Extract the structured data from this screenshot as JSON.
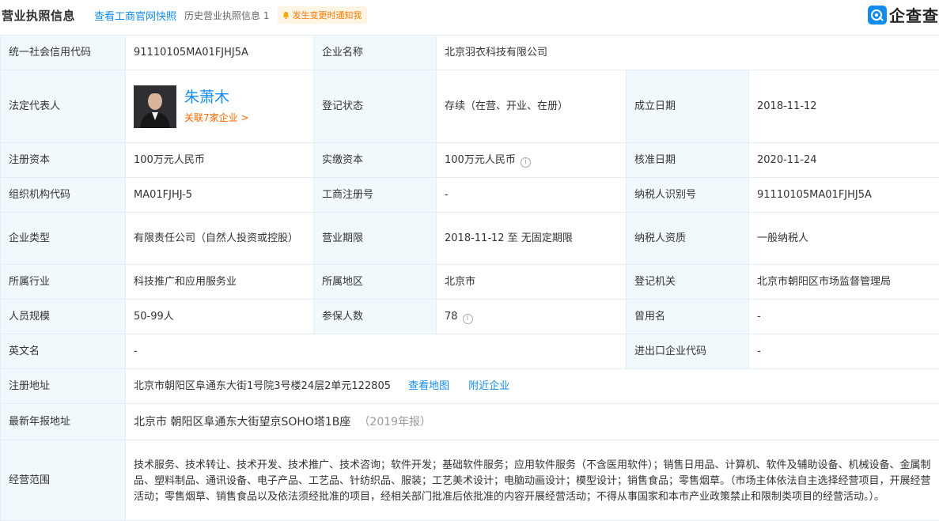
{
  "header": {
    "title": "营业执照信息",
    "snapshot_link": "查看工商官网快照",
    "history_label": "历史营业执照信息",
    "history_count": "1",
    "notify_label": "发生变更时通知我",
    "logo_text": "企查查"
  },
  "colors": {
    "accent": "#128bed",
    "label_bg": "#f2f9fc",
    "orange": "#ff6600"
  },
  "rows": {
    "credit_code": {
      "label": "统一社会信用代码",
      "value": "91110105MA01FJHJ5A"
    },
    "company_name": {
      "label": "企业名称",
      "value": "北京羽衣科技有限公司"
    },
    "legal_rep": {
      "label": "法定代表人",
      "name": "朱萧木",
      "related": "关联7家企业 >"
    },
    "reg_status": {
      "label": "登记状态",
      "value": "存续（在营、开业、在册）"
    },
    "founded": {
      "label": "成立日期",
      "value": "2018-11-12"
    },
    "reg_capital": {
      "label": "注册资本",
      "value": "100万元人民币"
    },
    "paid_capital": {
      "label": "实缴资本",
      "value": "100万元人民币"
    },
    "approved_date": {
      "label": "核准日期",
      "value": "2020-11-24"
    },
    "org_code": {
      "label": "组织机构代码",
      "value": "MA01FJHJ-5"
    },
    "biz_reg_no": {
      "label": "工商注册号",
      "value": "-"
    },
    "taxpayer_id": {
      "label": "纳税人识别号",
      "value": "91110105MA01FJHJ5A"
    },
    "company_type": {
      "label": "企业类型",
      "value": "有限责任公司（自然人投资或控股）"
    },
    "biz_term": {
      "label": "营业期限",
      "value": "2018-11-12 至 无固定期限"
    },
    "taxpayer_qual": {
      "label": "纳税人资质",
      "value": "一般纳税人"
    },
    "industry": {
      "label": "所属行业",
      "value": "科技推广和应用服务业"
    },
    "region": {
      "label": "所属地区",
      "value": "北京市"
    },
    "reg_authority": {
      "label": "登记机关",
      "value": "北京市朝阳区市场监督管理局"
    },
    "staff_size": {
      "label": "人员规模",
      "value": "50-99人"
    },
    "insured": {
      "label": "参保人数",
      "value": "78"
    },
    "former_name": {
      "label": "曾用名",
      "value": "-"
    },
    "english_name": {
      "label": "英文名",
      "value": "-"
    },
    "import_export": {
      "label": "进出口企业代码",
      "value": "-"
    },
    "reg_address": {
      "label": "注册地址",
      "value": "北京市朝阳区阜通东大街1号院3号楼24层2单元122805",
      "map_link": "查看地图",
      "nearby_link": "附近企业"
    },
    "annual_address": {
      "label": "最新年报地址",
      "value": "北京市 朝阳区阜通东大街望京SOHO塔1B座",
      "year": "（2019年报）"
    },
    "biz_scope": {
      "label": "经营范围",
      "value": "技术服务、技术转让、技术开发、技术推广、技术咨询；软件开发；基础软件服务；应用软件服务（不含医用软件）；销售日用品、计算机、软件及辅助设备、机械设备、金属制品、塑料制品、通讯设备、电子产品、工艺品、针纺织品、服装；工艺美术设计；电脑动画设计；模型设计；销售食品；零售烟草。（市场主体依法自主选择经营项目，开展经营活动；零售烟草、销售食品以及依法须经批准的项目，经相关部门批准后依批准的内容开展经营活动；不得从事国家和本市产业政策禁止和限制类项目的经营活动。）。"
    }
  }
}
